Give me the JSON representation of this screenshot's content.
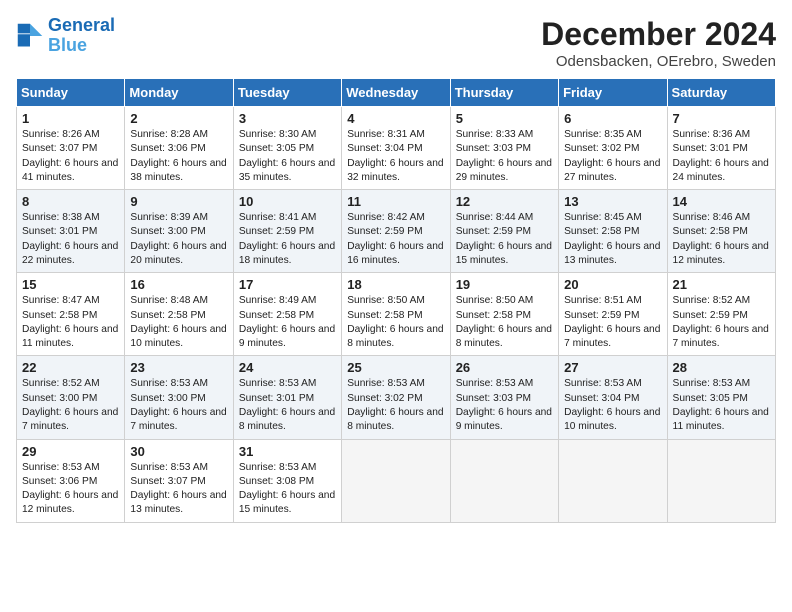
{
  "header": {
    "logo_general": "General",
    "logo_blue": "Blue",
    "title": "December 2024",
    "subtitle": "Odensbacken, OErebro, Sweden"
  },
  "weekdays": [
    "Sunday",
    "Monday",
    "Tuesday",
    "Wednesday",
    "Thursday",
    "Friday",
    "Saturday"
  ],
  "weeks": [
    [
      {
        "day": "1",
        "sunrise": "Sunrise: 8:26 AM",
        "sunset": "Sunset: 3:07 PM",
        "daylight": "Daylight: 6 hours and 41 minutes."
      },
      {
        "day": "2",
        "sunrise": "Sunrise: 8:28 AM",
        "sunset": "Sunset: 3:06 PM",
        "daylight": "Daylight: 6 hours and 38 minutes."
      },
      {
        "day": "3",
        "sunrise": "Sunrise: 8:30 AM",
        "sunset": "Sunset: 3:05 PM",
        "daylight": "Daylight: 6 hours and 35 minutes."
      },
      {
        "day": "4",
        "sunrise": "Sunrise: 8:31 AM",
        "sunset": "Sunset: 3:04 PM",
        "daylight": "Daylight: 6 hours and 32 minutes."
      },
      {
        "day": "5",
        "sunrise": "Sunrise: 8:33 AM",
        "sunset": "Sunset: 3:03 PM",
        "daylight": "Daylight: 6 hours and 29 minutes."
      },
      {
        "day": "6",
        "sunrise": "Sunrise: 8:35 AM",
        "sunset": "Sunset: 3:02 PM",
        "daylight": "Daylight: 6 hours and 27 minutes."
      },
      {
        "day": "7",
        "sunrise": "Sunrise: 8:36 AM",
        "sunset": "Sunset: 3:01 PM",
        "daylight": "Daylight: 6 hours and 24 minutes."
      }
    ],
    [
      {
        "day": "8",
        "sunrise": "Sunrise: 8:38 AM",
        "sunset": "Sunset: 3:01 PM",
        "daylight": "Daylight: 6 hours and 22 minutes."
      },
      {
        "day": "9",
        "sunrise": "Sunrise: 8:39 AM",
        "sunset": "Sunset: 3:00 PM",
        "daylight": "Daylight: 6 hours and 20 minutes."
      },
      {
        "day": "10",
        "sunrise": "Sunrise: 8:41 AM",
        "sunset": "Sunset: 2:59 PM",
        "daylight": "Daylight: 6 hours and 18 minutes."
      },
      {
        "day": "11",
        "sunrise": "Sunrise: 8:42 AM",
        "sunset": "Sunset: 2:59 PM",
        "daylight": "Daylight: 6 hours and 16 minutes."
      },
      {
        "day": "12",
        "sunrise": "Sunrise: 8:44 AM",
        "sunset": "Sunset: 2:59 PM",
        "daylight": "Daylight: 6 hours and 15 minutes."
      },
      {
        "day": "13",
        "sunrise": "Sunrise: 8:45 AM",
        "sunset": "Sunset: 2:58 PM",
        "daylight": "Daylight: 6 hours and 13 minutes."
      },
      {
        "day": "14",
        "sunrise": "Sunrise: 8:46 AM",
        "sunset": "Sunset: 2:58 PM",
        "daylight": "Daylight: 6 hours and 12 minutes."
      }
    ],
    [
      {
        "day": "15",
        "sunrise": "Sunrise: 8:47 AM",
        "sunset": "Sunset: 2:58 PM",
        "daylight": "Daylight: 6 hours and 11 minutes."
      },
      {
        "day": "16",
        "sunrise": "Sunrise: 8:48 AM",
        "sunset": "Sunset: 2:58 PM",
        "daylight": "Daylight: 6 hours and 10 minutes."
      },
      {
        "day": "17",
        "sunrise": "Sunrise: 8:49 AM",
        "sunset": "Sunset: 2:58 PM",
        "daylight": "Daylight: 6 hours and 9 minutes."
      },
      {
        "day": "18",
        "sunrise": "Sunrise: 8:50 AM",
        "sunset": "Sunset: 2:58 PM",
        "daylight": "Daylight: 6 hours and 8 minutes."
      },
      {
        "day": "19",
        "sunrise": "Sunrise: 8:50 AM",
        "sunset": "Sunset: 2:58 PM",
        "daylight": "Daylight: 6 hours and 8 minutes."
      },
      {
        "day": "20",
        "sunrise": "Sunrise: 8:51 AM",
        "sunset": "Sunset: 2:59 PM",
        "daylight": "Daylight: 6 hours and 7 minutes."
      },
      {
        "day": "21",
        "sunrise": "Sunrise: 8:52 AM",
        "sunset": "Sunset: 2:59 PM",
        "daylight": "Daylight: 6 hours and 7 minutes."
      }
    ],
    [
      {
        "day": "22",
        "sunrise": "Sunrise: 8:52 AM",
        "sunset": "Sunset: 3:00 PM",
        "daylight": "Daylight: 6 hours and 7 minutes."
      },
      {
        "day": "23",
        "sunrise": "Sunrise: 8:53 AM",
        "sunset": "Sunset: 3:00 PM",
        "daylight": "Daylight: 6 hours and 7 minutes."
      },
      {
        "day": "24",
        "sunrise": "Sunrise: 8:53 AM",
        "sunset": "Sunset: 3:01 PM",
        "daylight": "Daylight: 6 hours and 8 minutes."
      },
      {
        "day": "25",
        "sunrise": "Sunrise: 8:53 AM",
        "sunset": "Sunset: 3:02 PM",
        "daylight": "Daylight: 6 hours and 8 minutes."
      },
      {
        "day": "26",
        "sunrise": "Sunrise: 8:53 AM",
        "sunset": "Sunset: 3:03 PM",
        "daylight": "Daylight: 6 hours and 9 minutes."
      },
      {
        "day": "27",
        "sunrise": "Sunrise: 8:53 AM",
        "sunset": "Sunset: 3:04 PM",
        "daylight": "Daylight: 6 hours and 10 minutes."
      },
      {
        "day": "28",
        "sunrise": "Sunrise: 8:53 AM",
        "sunset": "Sunset: 3:05 PM",
        "daylight": "Daylight: 6 hours and 11 minutes."
      }
    ],
    [
      {
        "day": "29",
        "sunrise": "Sunrise: 8:53 AM",
        "sunset": "Sunset: 3:06 PM",
        "daylight": "Daylight: 6 hours and 12 minutes."
      },
      {
        "day": "30",
        "sunrise": "Sunrise: 8:53 AM",
        "sunset": "Sunset: 3:07 PM",
        "daylight": "Daylight: 6 hours and 13 minutes."
      },
      {
        "day": "31",
        "sunrise": "Sunrise: 8:53 AM",
        "sunset": "Sunset: 3:08 PM",
        "daylight": "Daylight: 6 hours and 15 minutes."
      },
      null,
      null,
      null,
      null
    ]
  ]
}
